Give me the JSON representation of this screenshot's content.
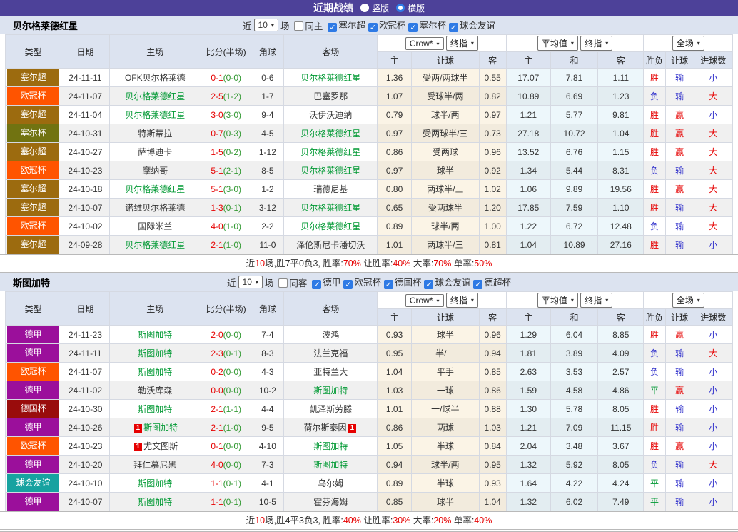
{
  "topbar": {
    "title": "近期战绩",
    "radios": [
      {
        "label": "竖版",
        "selected": false
      },
      {
        "label": "横版",
        "selected": true
      }
    ]
  },
  "table_header": {
    "type": "类型",
    "date": "日期",
    "home": "主场",
    "score": "比分(半场)",
    "corner": "角球",
    "away": "客场",
    "odds_select": "Crow*",
    "odds_select2": "终指",
    "avg_select": "平均值",
    "avg_select2": "终指",
    "period_select": "全场",
    "odds_home": "主",
    "odds_handicap": "让球",
    "odds_away": "客",
    "avg_home": "主",
    "avg_draw": "和",
    "avg_away": "客",
    "result": "胜负",
    "handicap_result": "让球",
    "goals": "进球数"
  },
  "badge_colors": {
    "塞尔超": "#9C6B0F",
    "欧冠杯": "#FF5400",
    "塞尔杯": "#717311",
    "德甲": "#9B0F9B",
    "德国杯": "#990C0C",
    "球会友谊": "#17A2A0"
  },
  "result_colors": {
    "胜": "#E60000",
    "负": "#3333CC",
    "平": "#009933",
    "赢": "#E60000",
    "输": "#3333CC",
    "大": "#E60000",
    "小": "#3333CC"
  },
  "sections": [
    {
      "team": "贝尔格莱德红星",
      "filters": {
        "prefix": "近",
        "count": "10",
        "suffix": "场",
        "same": {
          "label": "同主",
          "checked": false
        },
        "leagues": [
          {
            "label": "塞尔超",
            "checked": true
          },
          {
            "label": "欧冠杯",
            "checked": true
          },
          {
            "label": "塞尔杯",
            "checked": true
          },
          {
            "label": "球会友谊",
            "checked": true
          }
        ]
      },
      "rows": [
        {
          "type": "塞尔超",
          "date": "24-11-11",
          "home": "OFK贝尔格莱德",
          "home_focus": false,
          "home_card": false,
          "score": "0-1",
          "half": "(0-0)",
          "corner": "0-6",
          "away": "贝尔格莱德红星",
          "away_focus": true,
          "away_card": false,
          "o1": "1.36",
          "hc": "受两/两球半",
          "o2": "0.55",
          "a1": "17.07",
          "a2": "7.81",
          "a3": "1.11",
          "r": "胜",
          "hr": "输",
          "g": "小"
        },
        {
          "type": "欧冠杯",
          "date": "24-11-07",
          "home": "贝尔格莱德红星",
          "home_focus": true,
          "home_card": false,
          "score": "2-5",
          "half": "(1-2)",
          "corner": "1-7",
          "away": "巴塞罗那",
          "away_focus": false,
          "away_card": false,
          "o1": "1.07",
          "hc": "受球半/两",
          "o2": "0.82",
          "a1": "10.89",
          "a2": "6.69",
          "a3": "1.23",
          "r": "负",
          "hr": "输",
          "g": "大"
        },
        {
          "type": "塞尔超",
          "date": "24-11-04",
          "home": "贝尔格莱德红星",
          "home_focus": true,
          "home_card": false,
          "score": "3-0",
          "half": "(3-0)",
          "corner": "9-4",
          "away": "沃伊沃迪纳",
          "away_focus": false,
          "away_card": false,
          "o1": "0.79",
          "hc": "球半/两",
          "o2": "0.97",
          "a1": "1.21",
          "a2": "5.77",
          "a3": "9.81",
          "r": "胜",
          "hr": "赢",
          "g": "小"
        },
        {
          "type": "塞尔杯",
          "date": "24-10-31",
          "home": "特斯蒂拉",
          "home_focus": false,
          "home_card": false,
          "score": "0-7",
          "half": "(0-3)",
          "corner": "4-5",
          "away": "贝尔格莱德红星",
          "away_focus": true,
          "away_card": false,
          "o1": "0.97",
          "hc": "受两球半/三",
          "o2": "0.73",
          "a1": "27.18",
          "a2": "10.72",
          "a3": "1.04",
          "r": "胜",
          "hr": "赢",
          "g": "大"
        },
        {
          "type": "塞尔超",
          "date": "24-10-27",
          "home": "萨博迪卡",
          "home_focus": false,
          "home_card": false,
          "score": "1-5",
          "half": "(0-2)",
          "corner": "1-12",
          "away": "贝尔格莱德红星",
          "away_focus": true,
          "away_card": false,
          "o1": "0.86",
          "hc": "受两球",
          "o2": "0.96",
          "a1": "13.52",
          "a2": "6.76",
          "a3": "1.15",
          "r": "胜",
          "hr": "赢",
          "g": "大"
        },
        {
          "type": "欧冠杯",
          "date": "24-10-23",
          "home": "摩纳哥",
          "home_focus": false,
          "home_card": false,
          "score": "5-1",
          "half": "(2-1)",
          "corner": "8-5",
          "away": "贝尔格莱德红星",
          "away_focus": true,
          "away_card": false,
          "o1": "0.97",
          "hc": "球半",
          "o2": "0.92",
          "a1": "1.34",
          "a2": "5.44",
          "a3": "8.31",
          "r": "负",
          "hr": "输",
          "g": "大"
        },
        {
          "type": "塞尔超",
          "date": "24-10-18",
          "home": "贝尔格莱德红星",
          "home_focus": true,
          "home_card": false,
          "score": "5-1",
          "half": "(3-0)",
          "corner": "1-2",
          "away": "瑞德尼基",
          "away_focus": false,
          "away_card": false,
          "o1": "0.80",
          "hc": "两球半/三",
          "o2": "1.02",
          "a1": "1.06",
          "a2": "9.89",
          "a3": "19.56",
          "r": "胜",
          "hr": "赢",
          "g": "大"
        },
        {
          "type": "塞尔超",
          "date": "24-10-07",
          "home": "诺维贝尔格莱德",
          "home_focus": false,
          "home_card": false,
          "score": "1-3",
          "half": "(0-1)",
          "corner": "3-12",
          "away": "贝尔格莱德红星",
          "away_focus": true,
          "away_card": false,
          "o1": "0.65",
          "hc": "受两球半",
          "o2": "1.20",
          "a1": "17.85",
          "a2": "7.59",
          "a3": "1.10",
          "r": "胜",
          "hr": "输",
          "g": "大"
        },
        {
          "type": "欧冠杯",
          "date": "24-10-02",
          "home": "国际米兰",
          "home_focus": false,
          "home_card": false,
          "score": "4-0",
          "half": "(1-0)",
          "corner": "2-2",
          "away": "贝尔格莱德红星",
          "away_focus": true,
          "away_card": false,
          "o1": "0.89",
          "hc": "球半/两",
          "o2": "1.00",
          "a1": "1.22",
          "a2": "6.72",
          "a3": "12.48",
          "r": "负",
          "hr": "输",
          "g": "大"
        },
        {
          "type": "塞尔超",
          "date": "24-09-28",
          "home": "贝尔格莱德红星",
          "home_focus": true,
          "home_card": false,
          "score": "2-1",
          "half": "(1-0)",
          "corner": "11-0",
          "away": "泽伦斯尼卡潘切沃",
          "away_focus": false,
          "away_card": false,
          "o1": "1.01",
          "hc": "两球半/三",
          "o2": "0.81",
          "a1": "1.04",
          "a2": "10.89",
          "a3": "27.16",
          "r": "胜",
          "hr": "输",
          "g": "小"
        }
      ],
      "summary": [
        {
          "t": "近",
          "red": false
        },
        {
          "t": "10",
          "red": true
        },
        {
          "t": "场,胜7平0负3, 胜率:",
          "red": false
        },
        {
          "t": "70%",
          "red": true
        },
        {
          "t": " 让胜率:",
          "red": false
        },
        {
          "t": "40%",
          "red": true
        },
        {
          "t": " 大率:",
          "red": false
        },
        {
          "t": "70%",
          "red": true
        },
        {
          "t": " 单率:",
          "red": false
        },
        {
          "t": "50%",
          "red": true
        }
      ]
    },
    {
      "team": "斯图加特",
      "filters": {
        "prefix": "近",
        "count": "10",
        "suffix": "场",
        "same": {
          "label": "同客",
          "checked": false
        },
        "leagues": [
          {
            "label": "德甲",
            "checked": true
          },
          {
            "label": "欧冠杯",
            "checked": true
          },
          {
            "label": "德国杯",
            "checked": true
          },
          {
            "label": "球会友谊",
            "checked": true
          },
          {
            "label": "德超杯",
            "checked": true
          }
        ]
      },
      "rows": [
        {
          "type": "德甲",
          "date": "24-11-23",
          "home": "斯图加特",
          "home_focus": true,
          "home_card": false,
          "score": "2-0",
          "half": "(0-0)",
          "corner": "7-4",
          "away": "波鸿",
          "away_focus": false,
          "away_card": false,
          "o1": "0.93",
          "hc": "球半",
          "o2": "0.96",
          "a1": "1.29",
          "a2": "6.04",
          "a3": "8.85",
          "r": "胜",
          "hr": "赢",
          "g": "小"
        },
        {
          "type": "德甲",
          "date": "24-11-11",
          "home": "斯图加特",
          "home_focus": true,
          "home_card": false,
          "score": "2-3",
          "half": "(0-1)",
          "corner": "8-3",
          "away": "法兰克福",
          "away_focus": false,
          "away_card": false,
          "o1": "0.95",
          "hc": "半/一",
          "o2": "0.94",
          "a1": "1.81",
          "a2": "3.89",
          "a3": "4.09",
          "r": "负",
          "hr": "输",
          "g": "大"
        },
        {
          "type": "欧冠杯",
          "date": "24-11-07",
          "home": "斯图加特",
          "home_focus": true,
          "home_card": false,
          "score": "0-2",
          "half": "(0-0)",
          "corner": "4-3",
          "away": "亚特兰大",
          "away_focus": false,
          "away_card": false,
          "o1": "1.04",
          "hc": "平手",
          "o2": "0.85",
          "a1": "2.63",
          "a2": "3.53",
          "a3": "2.57",
          "r": "负",
          "hr": "输",
          "g": "小"
        },
        {
          "type": "德甲",
          "date": "24-11-02",
          "home": "勒沃库森",
          "home_focus": false,
          "home_card": false,
          "score": "0-0",
          "half": "(0-0)",
          "corner": "10-2",
          "away": "斯图加特",
          "away_focus": true,
          "away_card": false,
          "o1": "1.03",
          "hc": "一球",
          "o2": "0.86",
          "a1": "1.59",
          "a2": "4.58",
          "a3": "4.86",
          "r": "平",
          "hr": "赢",
          "g": "小"
        },
        {
          "type": "德国杯",
          "date": "24-10-30",
          "home": "斯图加特",
          "home_focus": true,
          "home_card": false,
          "score": "2-1",
          "half": "(1-1)",
          "corner": "4-4",
          "away": "凯泽斯劳滕",
          "away_focus": false,
          "away_card": false,
          "o1": "1.01",
          "hc": "一/球半",
          "o2": "0.88",
          "a1": "1.30",
          "a2": "5.78",
          "a3": "8.05",
          "r": "胜",
          "hr": "输",
          "g": "小"
        },
        {
          "type": "德甲",
          "date": "24-10-26",
          "home": "斯图加特",
          "home_focus": true,
          "home_card": true,
          "score": "2-1",
          "half": "(1-0)",
          "corner": "9-5",
          "away": "荷尔斯泰因",
          "away_focus": false,
          "away_card": true,
          "o1": "0.86",
          "hc": "两球",
          "o2": "1.03",
          "a1": "1.21",
          "a2": "7.09",
          "a3": "11.15",
          "r": "胜",
          "hr": "输",
          "g": "小"
        },
        {
          "type": "欧冠杯",
          "date": "24-10-23",
          "home": "尤文图斯",
          "home_focus": false,
          "home_card": true,
          "score": "0-1",
          "half": "(0-0)",
          "corner": "4-10",
          "away": "斯图加特",
          "away_focus": true,
          "away_card": false,
          "o1": "1.05",
          "hc": "半球",
          "o2": "0.84",
          "a1": "2.04",
          "a2": "3.48",
          "a3": "3.67",
          "r": "胜",
          "hr": "赢",
          "g": "小"
        },
        {
          "type": "德甲",
          "date": "24-10-20",
          "home": "拜仁慕尼黑",
          "home_focus": false,
          "home_card": false,
          "score": "4-0",
          "half": "(0-0)",
          "corner": "7-3",
          "away": "斯图加特",
          "away_focus": true,
          "away_card": false,
          "o1": "0.94",
          "hc": "球半/两",
          "o2": "0.95",
          "a1": "1.32",
          "a2": "5.92",
          "a3": "8.05",
          "r": "负",
          "hr": "输",
          "g": "大"
        },
        {
          "type": "球会友谊",
          "date": "24-10-10",
          "home": "斯图加特",
          "home_focus": true,
          "home_card": false,
          "score": "1-1",
          "half": "(0-1)",
          "corner": "4-1",
          "away": "乌尔姆",
          "away_focus": false,
          "away_card": false,
          "o1": "0.89",
          "hc": "半球",
          "o2": "0.93",
          "a1": "1.64",
          "a2": "4.22",
          "a3": "4.24",
          "r": "平",
          "hr": "输",
          "g": "小"
        },
        {
          "type": "德甲",
          "date": "24-10-07",
          "home": "斯图加特",
          "home_focus": true,
          "home_card": false,
          "score": "1-1",
          "half": "(0-1)",
          "corner": "10-5",
          "away": "霍芬海姆",
          "away_focus": false,
          "away_card": false,
          "o1": "0.85",
          "hc": "球半",
          "o2": "1.04",
          "a1": "1.32",
          "a2": "6.02",
          "a3": "7.49",
          "r": "平",
          "hr": "输",
          "g": "小"
        }
      ],
      "summary": [
        {
          "t": "近",
          "red": false
        },
        {
          "t": "10",
          "red": true
        },
        {
          "t": "场,胜4平3负3, 胜率:",
          "red": false
        },
        {
          "t": "40%",
          "red": true
        },
        {
          "t": " 让胜率:",
          "red": false
        },
        {
          "t": "30%",
          "red": true
        },
        {
          "t": " 大率:",
          "red": false
        },
        {
          "t": "20%",
          "red": true
        },
        {
          "t": " 单率:",
          "red": false
        },
        {
          "t": "40%",
          "red": true
        }
      ]
    }
  ]
}
